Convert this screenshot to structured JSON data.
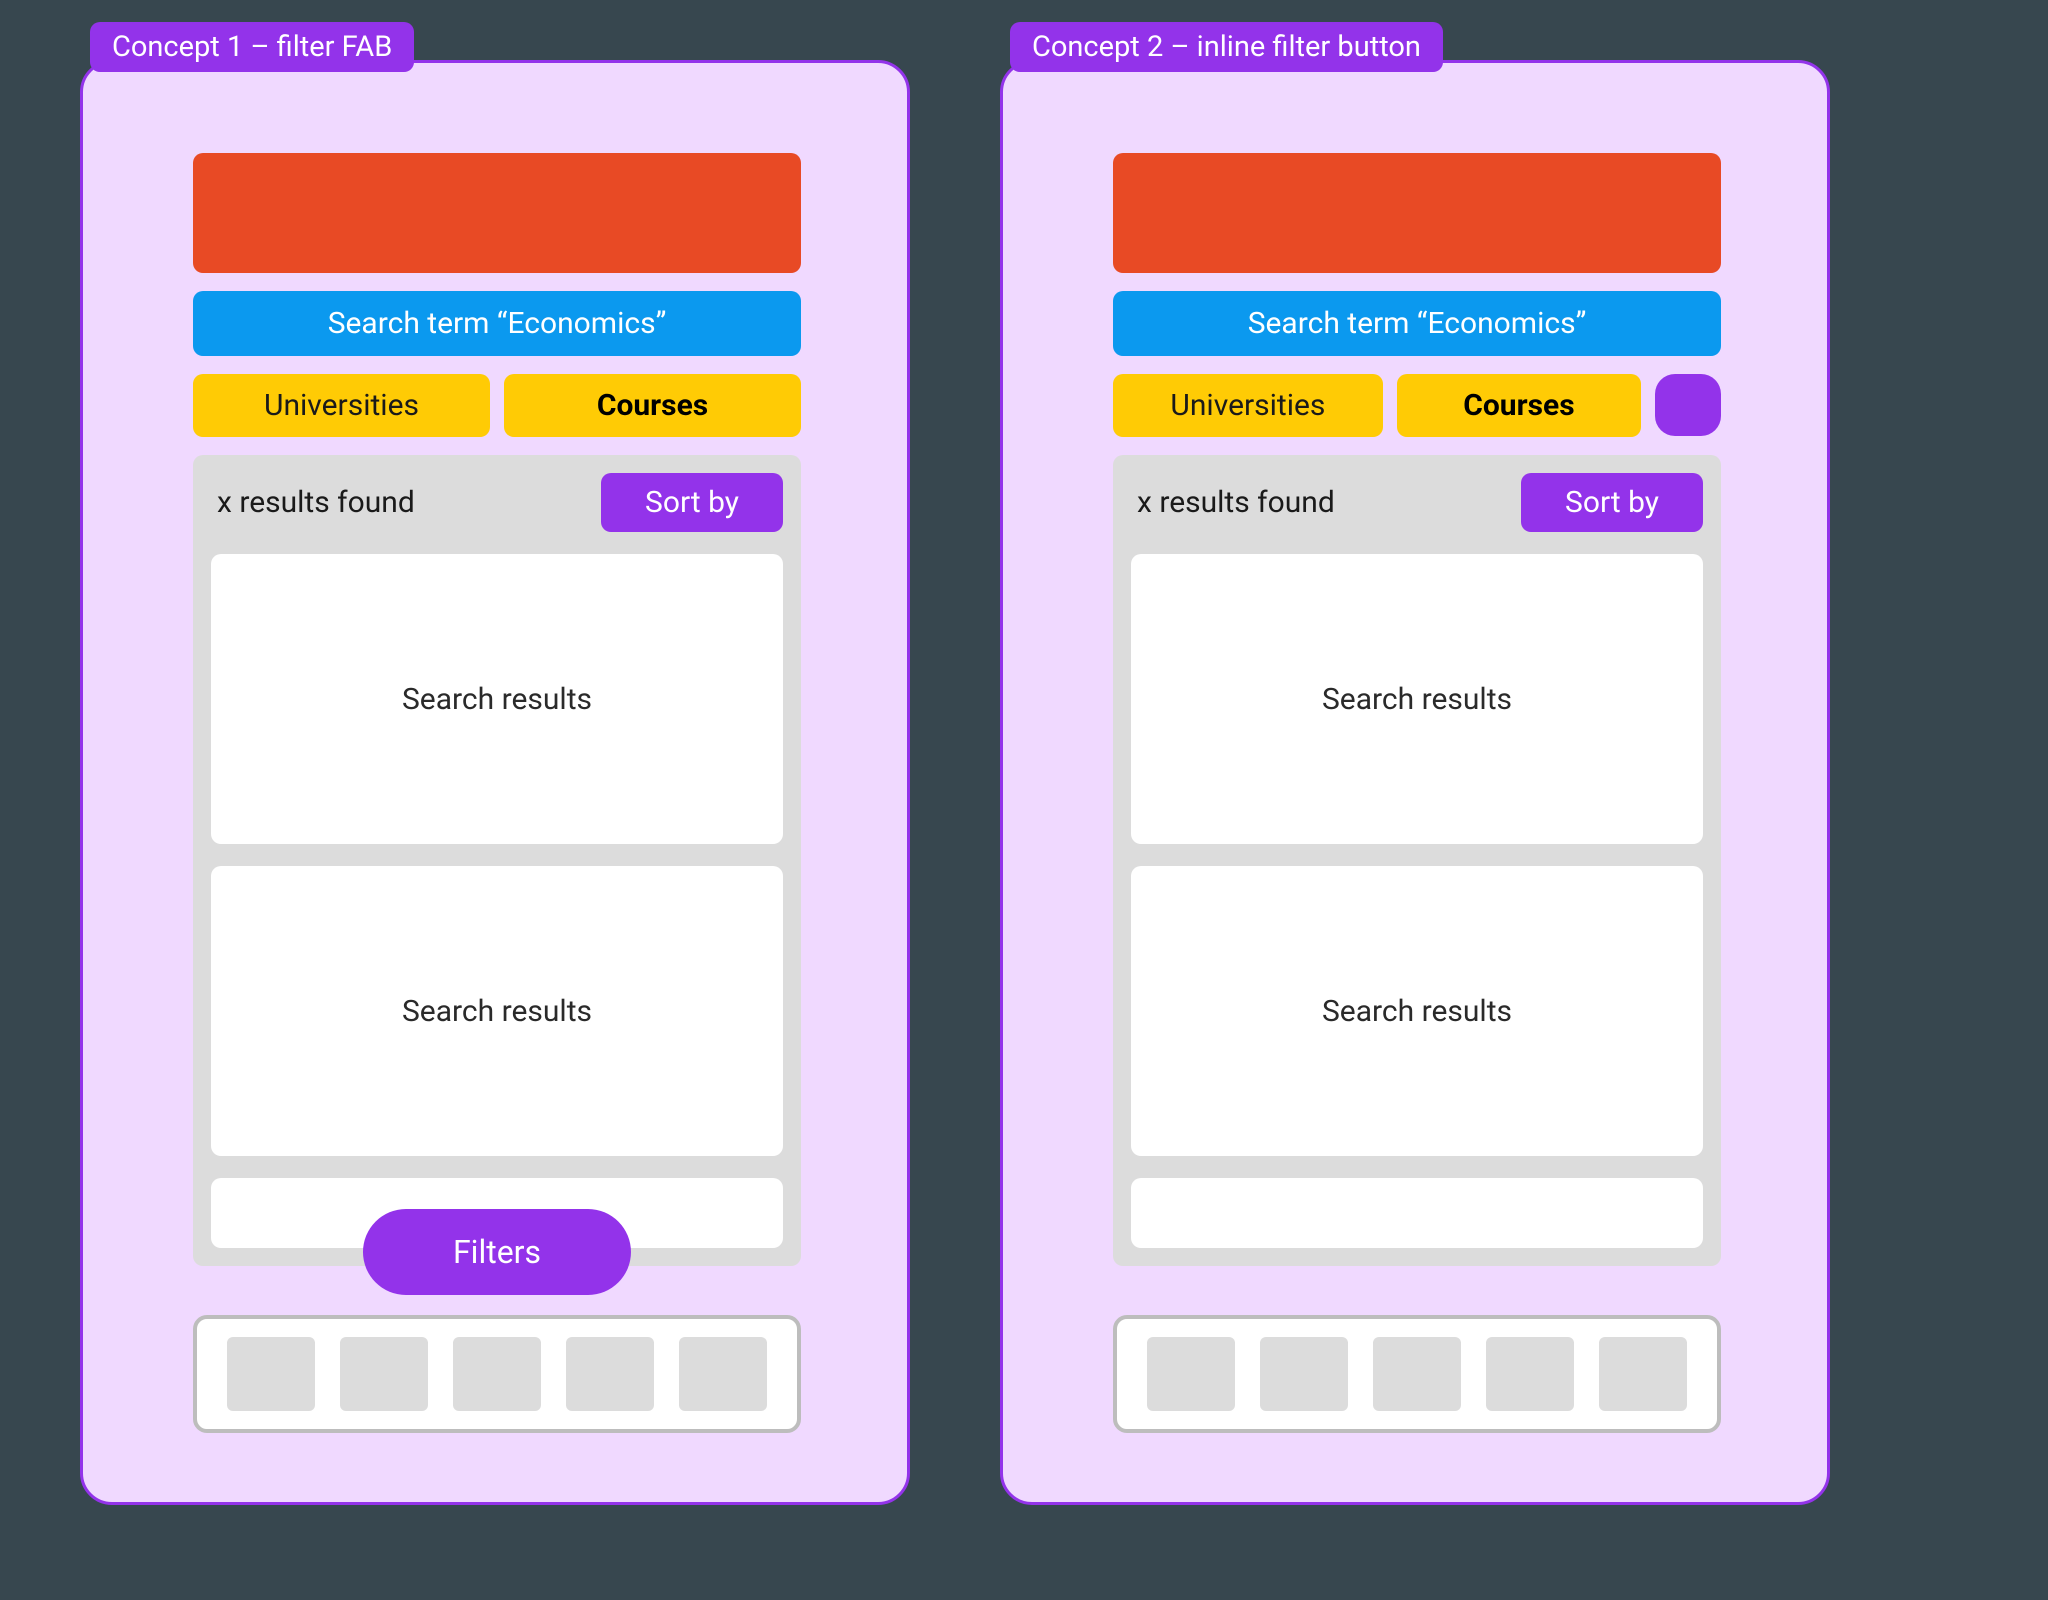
{
  "concept1": {
    "label": "Concept 1 – filter FAB",
    "search_bar": "Search term “Economics”",
    "tabs": {
      "universities": "Universities",
      "courses": "Courses"
    },
    "results_count": "x results found",
    "sort_label": "Sort by",
    "result_cards": [
      "Search results",
      "Search results"
    ],
    "fab_label": "Filters"
  },
  "concept2": {
    "label": "Concept 2 – inline filter button",
    "search_bar": "Search term “Economics”",
    "tabs": {
      "universities": "Universities",
      "courses": "Courses"
    },
    "results_count": "x results found",
    "sort_label": "Sort by",
    "result_cards": [
      "Search results",
      "Search results"
    ]
  },
  "colors": {
    "accent": "#9333ea",
    "banner": "#e84a25",
    "search": "#0b99ef",
    "tab": "#ffcb05",
    "frame_bg": "#f0d9ff"
  }
}
